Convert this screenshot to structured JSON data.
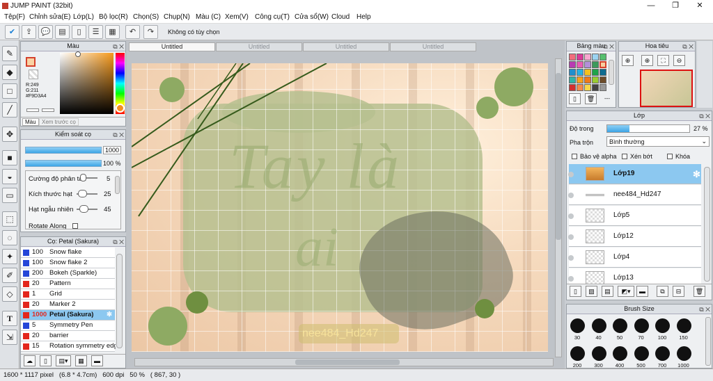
{
  "app": {
    "title": "JUMP PAINT (32bit)",
    "window_buttons": [
      "—",
      "❐",
      "✕"
    ]
  },
  "menu": [
    "Tệp(F)",
    "Chỉnh sửa(E)",
    "Lớp(L)",
    "Bộ lọc(R)",
    "Chọn(S)",
    "Chụp(N)",
    "Màu (C)",
    "Xem(V)",
    "Công cụ(T)",
    "Cửa sổ(W)",
    "Cloud",
    "Help"
  ],
  "toolbar": {
    "status": "Không có tùy chọn"
  },
  "color_panel": {
    "title": "Màu",
    "r": "R:249",
    "g": "G:211",
    "hex": "#F9D3A4",
    "tabs": [
      "Màu",
      "Xem trước cọ"
    ]
  },
  "brush_control": {
    "title": "Kiểm soát cọ",
    "size_value": "1000",
    "opacity_value": "100 %",
    "rows": [
      {
        "label": "Cường độ phân tán",
        "value": "5"
      },
      {
        "label": "Kích thước hạt",
        "value": "25"
      },
      {
        "label": "Hạt ngẫu nhiên",
        "value": "45"
      },
      {
        "label": "Rotate Along",
        "value": ""
      }
    ]
  },
  "brush_list": {
    "title": "Cọ: Petal (Sakura)",
    "items": [
      {
        "size": "100",
        "name": "Snow flake",
        "color": "#2546d8"
      },
      {
        "size": "100",
        "name": "Snow flake 2",
        "color": "#2546d8"
      },
      {
        "size": "200",
        "name": "Bokeh (Sparkle)",
        "color": "#2546d8"
      },
      {
        "size": "20",
        "name": "Pattern",
        "color": "#e3261c"
      },
      {
        "size": "1",
        "name": "Grid",
        "color": "#e3261c"
      },
      {
        "size": "20",
        "name": "Marker 2",
        "color": "#e3261c"
      },
      {
        "size": "1000",
        "name": "Petal (Sakura)",
        "color": "#e3261c",
        "selected": true
      },
      {
        "size": "5",
        "name": "Symmetry Pen",
        "color": "#2546d8"
      },
      {
        "size": "20",
        "name": "barrier",
        "color": "#e3261c"
      },
      {
        "size": "15",
        "name": "Rotation symmetry edge",
        "color": "#e3261c"
      }
    ]
  },
  "tabs": [
    "Untitled",
    "Untitled",
    "Untitled",
    "Untitled"
  ],
  "canvas": {
    "text1": "Tay là",
    "text2": "ai",
    "watermark": "nee484_Hd247"
  },
  "palette": {
    "title": "Bảng màu",
    "extra": "---"
  },
  "navigator": {
    "title": "Hoa tiêu"
  },
  "layers": {
    "title": "Lớp",
    "opacity_label": "Độ trong",
    "opacity_value": "27 %",
    "opacity_fraction": 0.27,
    "blend_label": "Pha trộn",
    "blend_value": "Bình thường",
    "checks": [
      "Bảo vệ alpha",
      "Xén bớt",
      "Khóa"
    ],
    "items": [
      {
        "name": "Lớp19",
        "selected": true
      },
      {
        "name": "nee484_Hd247"
      },
      {
        "name": "Lớp5"
      },
      {
        "name": "Lớp12"
      },
      {
        "name": "Lớp4"
      },
      {
        "name": "Lớp13"
      }
    ]
  },
  "brush_size": {
    "title": "Brush Size",
    "row1": [
      "30",
      "40",
      "50",
      "70",
      "100",
      "150"
    ],
    "row2": [
      "200",
      "300",
      "400",
      "500",
      "700",
      "1000"
    ]
  },
  "status": {
    "text": "1600 * 1117 pixel   (6.8 * 4.7cm)   600 dpi   50 %   ( 867, 30 )"
  }
}
